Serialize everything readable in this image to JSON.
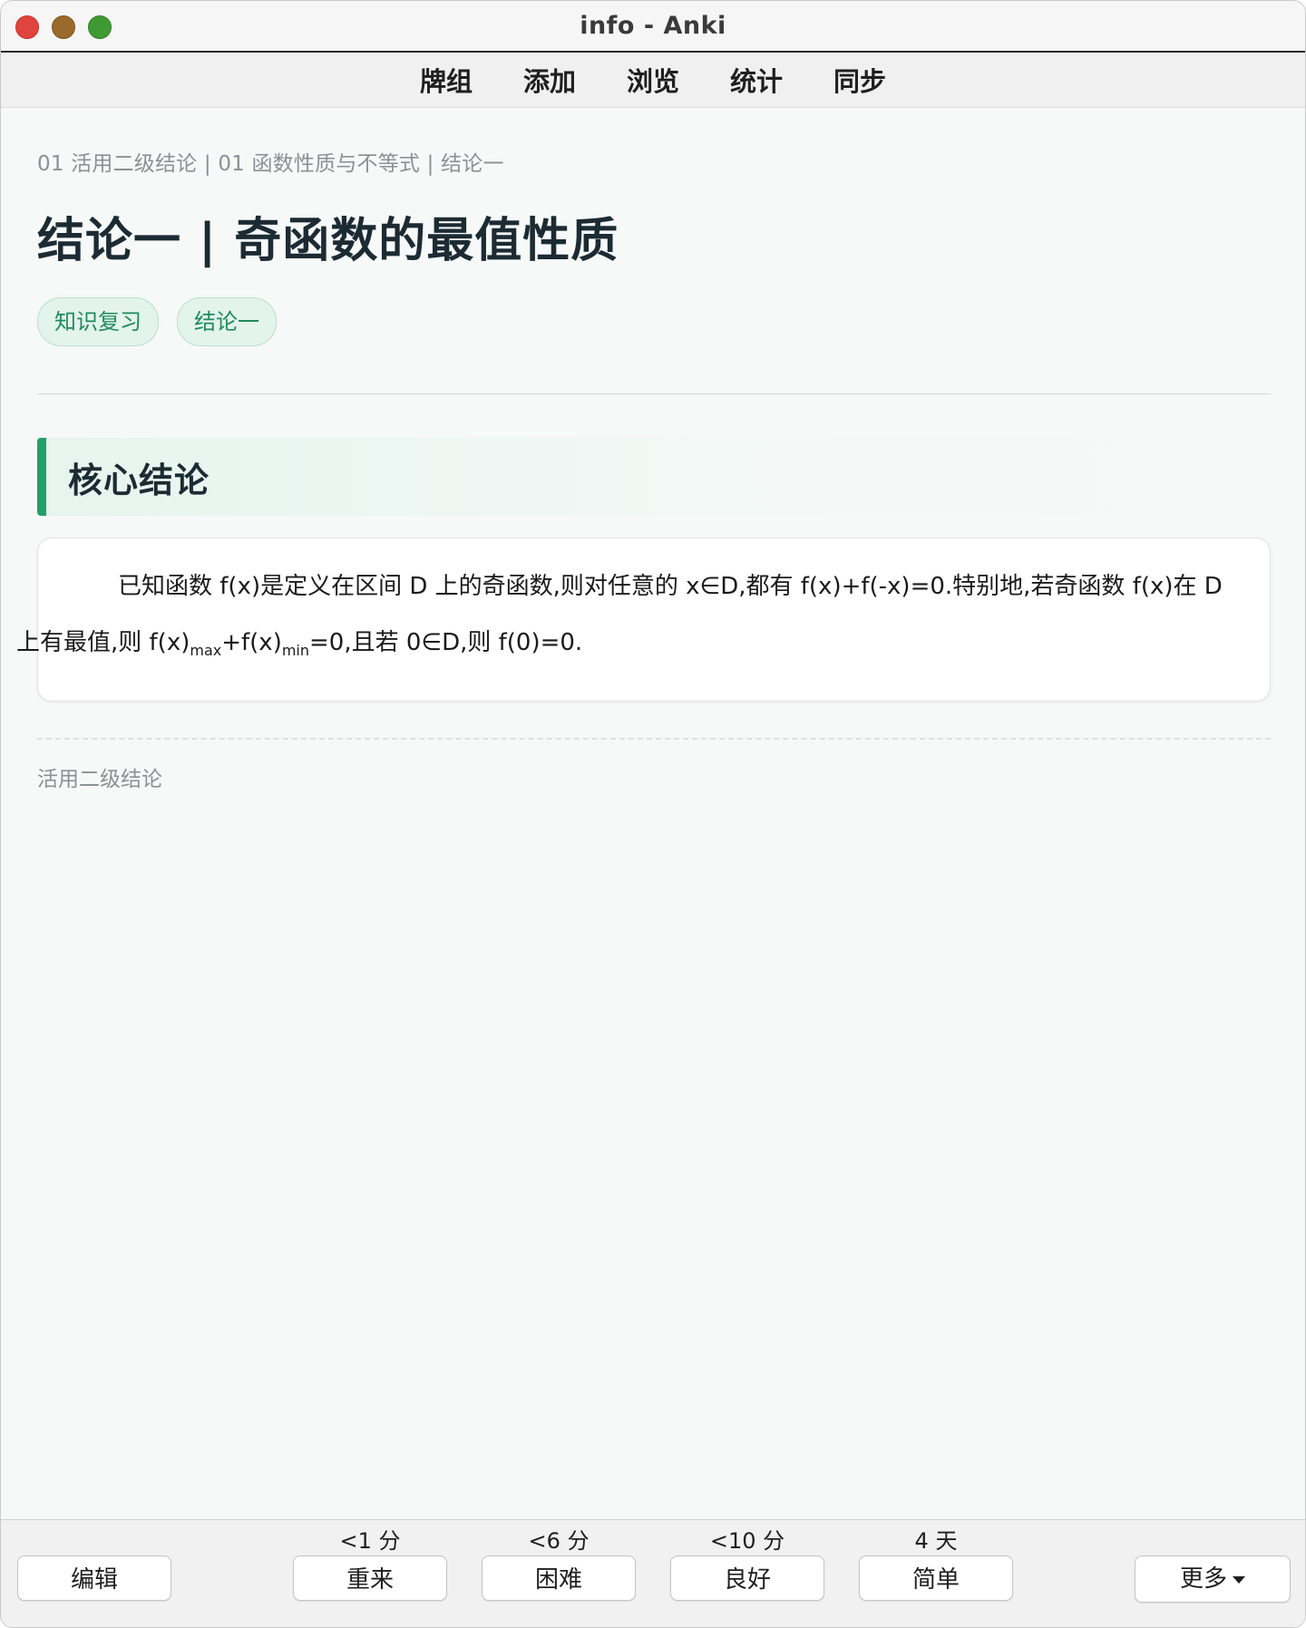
{
  "window": {
    "title": "info - Anki"
  },
  "topnav": {
    "items": [
      "牌组",
      "添加",
      "浏览",
      "统计",
      "同步"
    ]
  },
  "card": {
    "breadcrumb": "01 活用二级结论 | 01 函数性质与不等式 | 结论一",
    "title": "结论一 |  奇函数的最值性质",
    "tags": [
      "知识复习",
      "结论一"
    ],
    "section_title": "核心结论",
    "body_line1": "已知函数 f(x)是定义在区间 D 上的奇函数,则对任意的 x∈D,都有 f(x)+f(-x)=0.特别地,若奇函数 f(x)在 D",
    "body_line2_a": "上有最值,则 f(x)",
    "body_sub_max": "max",
    "body_line2_b": "+f(x)",
    "body_sub_min": "min",
    "body_line2_c": "=0,且若 0∈D,则 f(0)=0.",
    "footer_note": "活用二级结论"
  },
  "bottombar": {
    "edit_label": "编辑",
    "answers": [
      {
        "label": "重来",
        "interval": "<1 分"
      },
      {
        "label": "困难",
        "interval": "<6 分"
      },
      {
        "label": "良好",
        "interval": "<10 分"
      },
      {
        "label": "简单",
        "interval": "4 天"
      }
    ],
    "more_label": "更多"
  },
  "colors": {
    "accent": "#22a06b",
    "tag_bg": "#e3f4ec",
    "tag_text": "#1f8a5c",
    "title_text": "#1c2b33"
  }
}
